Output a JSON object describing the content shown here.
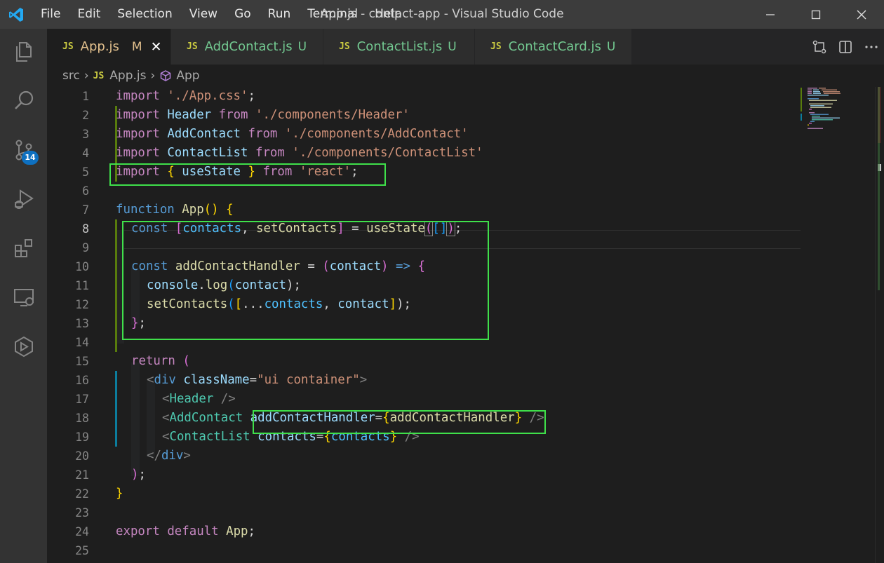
{
  "window": {
    "title": "App.js - contact-app - Visual Studio Code",
    "menu": [
      "File",
      "Edit",
      "Selection",
      "View",
      "Go",
      "Run",
      "Terminal",
      "Help"
    ]
  },
  "activity_bar": {
    "scm_badge": "14",
    "icons": [
      "explorer-icon",
      "search-icon",
      "source-control-icon",
      "run-debug-icon",
      "extensions-icon",
      "remote-explorer-icon",
      "live-share-icon"
    ]
  },
  "tabs": [
    {
      "icon": "JS",
      "name": "App.js",
      "status": "M",
      "active": true
    },
    {
      "icon": "JS",
      "name": "AddContact.js",
      "status": "U",
      "active": false
    },
    {
      "icon": "JS",
      "name": "ContactList.js",
      "status": "U",
      "active": false
    },
    {
      "icon": "JS",
      "name": "ContactCard.js",
      "status": "U",
      "active": false
    }
  ],
  "breadcrumb": {
    "folder": "src",
    "file_icon": "JS",
    "file": "App.js",
    "symbol": "App"
  },
  "editor": {
    "current_line": 8,
    "lines": [
      {
        "n": "1"
      },
      {
        "n": "2"
      },
      {
        "n": "3"
      },
      {
        "n": "4"
      },
      {
        "n": "5"
      },
      {
        "n": "6"
      },
      {
        "n": "7"
      },
      {
        "n": "8"
      },
      {
        "n": "9"
      },
      {
        "n": "10"
      },
      {
        "n": "11"
      },
      {
        "n": "12"
      },
      {
        "n": "13"
      },
      {
        "n": "14"
      },
      {
        "n": "15"
      },
      {
        "n": "16"
      },
      {
        "n": "17"
      },
      {
        "n": "18"
      },
      {
        "n": "19"
      },
      {
        "n": "20"
      },
      {
        "n": "21"
      },
      {
        "n": "22"
      },
      {
        "n": "23"
      },
      {
        "n": "24"
      },
      {
        "n": "25"
      }
    ],
    "code": {
      "l1": [
        "import",
        " ",
        "'./App.css'",
        ";"
      ],
      "l2": [
        "import",
        " ",
        "Header",
        " ",
        "from",
        " ",
        "'./components/Header'"
      ],
      "l3": [
        "import",
        " ",
        "AddContact",
        " ",
        "from",
        " ",
        "'./components/AddContact'"
      ],
      "l4": [
        "import",
        " ",
        "ContactList",
        " ",
        "from",
        " ",
        "'./components/ContactList'"
      ],
      "l5": [
        "import",
        " ",
        "{",
        " useState ",
        "}",
        " ",
        "from",
        " ",
        "'react'",
        ";"
      ],
      "l7": [
        "function",
        " ",
        "App",
        "()",
        " ",
        "{"
      ],
      "l8": [
        "const",
        " ",
        "[",
        "contacts",
        ", ",
        "setContacts",
        "]",
        " = ",
        "useState",
        "(",
        "[]",
        ")",
        ";"
      ],
      "l10": [
        "const",
        " ",
        "addContactHandler",
        " = ",
        "(",
        "contact",
        ")",
        " ",
        "=>",
        " ",
        "{"
      ],
      "l11": [
        "console",
        ".",
        "log",
        "(",
        "contact",
        ");"
      ],
      "l12": [
        "setContacts",
        "(",
        "[",
        "...",
        "contacts",
        ", ",
        "contact",
        "]",
        ");"
      ],
      "l13": [
        "}",
        ";"
      ],
      "l15": [
        "return",
        " ",
        "("
      ],
      "l16": [
        "<",
        "div",
        " ",
        "className",
        "=",
        "\"ui container\"",
        ">"
      ],
      "l17": [
        "<",
        "Header",
        " />"
      ],
      "l18": [
        "<",
        "AddContact",
        " ",
        "addContactHandler",
        "=",
        "{",
        "addContactHandler",
        "}",
        " />"
      ],
      "l19": [
        "<",
        "ContactList",
        " ",
        "contacts",
        "=",
        "{",
        "contacts",
        "}",
        " />"
      ],
      "l20": [
        "</",
        "div",
        ">"
      ],
      "l21": [
        ")",
        ";"
      ],
      "l22": [
        "}"
      ],
      "l24": [
        "export",
        " ",
        "default",
        " ",
        "App",
        ";"
      ]
    }
  },
  "colors": {
    "keyword_control": "#c586c0",
    "keyword": "#569cd6",
    "string": "#ce9178",
    "variable": "#9cdcfe",
    "function": "#dcdcaa",
    "component": "#4ec9b0",
    "highlight_box": "#3fe04a",
    "added_gutter": "#587c0c",
    "modified_gutter": "#0c7d9d"
  }
}
